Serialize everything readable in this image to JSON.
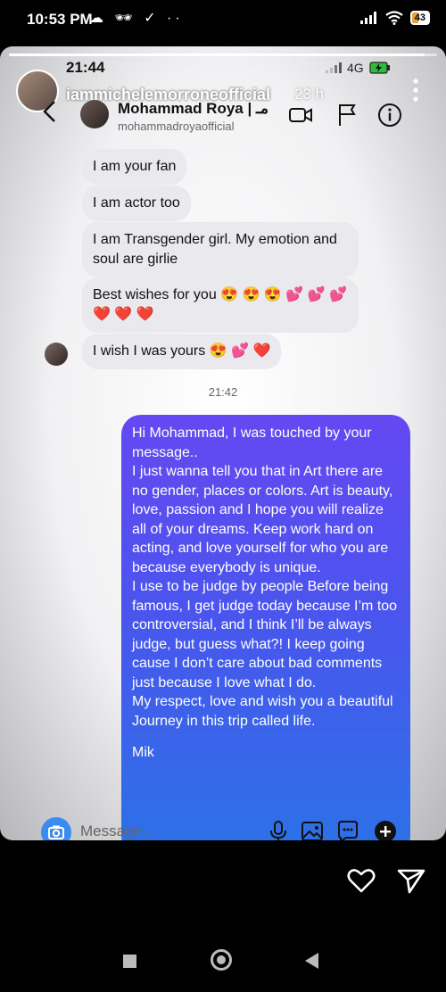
{
  "os_status": {
    "time": "10:53 PM",
    "icons": "☁ 🕶 ✓ ··",
    "battery": "43"
  },
  "story": {
    "progress": 0.97,
    "username": "iammichelemorroneofficial",
    "age": "23 h"
  },
  "inner_status": {
    "time": "21:44",
    "network": "4G"
  },
  "chat_header": {
    "name": "Mohammad Roya | مـ",
    "handle": "mohammadroyaofficial"
  },
  "messages_in": [
    {
      "text": "I am your fan"
    },
    {
      "text": "I am actor too"
    },
    {
      "text": "I am Transgender girl. My emotion and soul are girlie"
    },
    {
      "text": "Best wishes for you 😍 😍 😍 💕 💕 💕 ❤️ ❤️ ❤️"
    },
    {
      "text": "I wish I was yours 😍 💕 ❤️"
    }
  ],
  "timestamp": "21:42",
  "reply": {
    "paragraphs": [
      "Hi Mohammad, I was touched by your message..",
      "I just wanna tell you that in Art there are no gender, places or colors. Art is beauty, love, passion and I hope you will realize all of your dreams. Keep work hard on acting, and love yourself for who you are because everybody is unique.",
      "I use to be judge by people Before being famous, I get judge today because I’m too controversial, and I think I’ll be always judge, but guess what?! I keep going cause I don’t care about bad comments just because I love what I do.",
      "My respect, love and wish you a beautiful Journey in this trip called life."
    ],
    "signature": "Mik"
  },
  "composer": {
    "placeholder": "Message..."
  }
}
